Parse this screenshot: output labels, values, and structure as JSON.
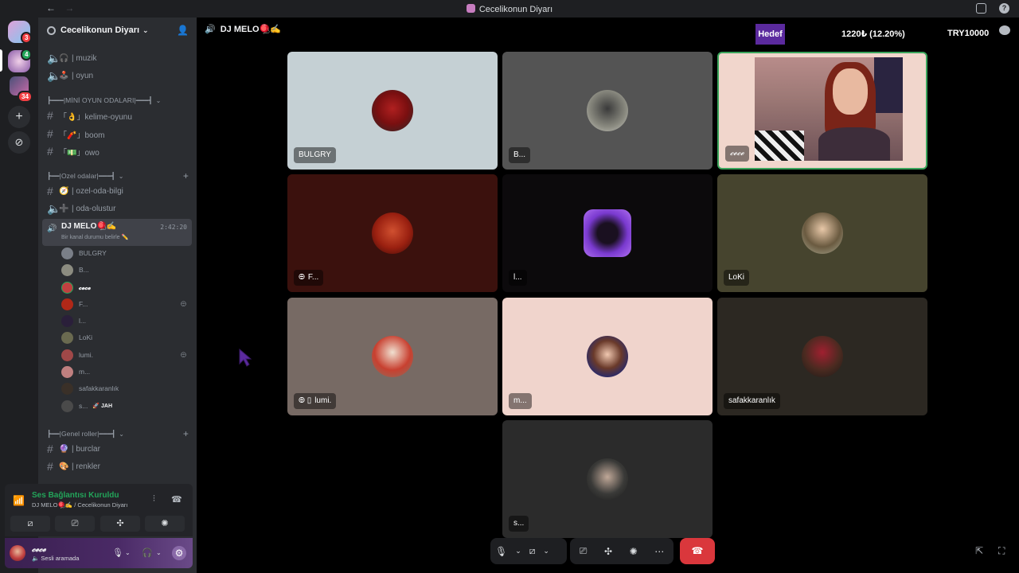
{
  "titlebar": {
    "title": "Cecelikonun Diyarı",
    "back": "←",
    "forward": "→"
  },
  "guilds": [
    {
      "badge": "3"
    },
    {
      "badge": "4"
    },
    {
      "badge": "34"
    }
  ],
  "server": {
    "name": "Cecelikonun Diyarı"
  },
  "channels_top": [
    {
      "emoji": "🎧",
      "label": "| muzik"
    },
    {
      "emoji": "🕹️",
      "label": "| oyun"
    }
  ],
  "categories": {
    "mini": "┣━━━|MİNİ OYUN ODALARI|━━━┫",
    "ozel": "┣━━|Ozel odalar|━━━┫",
    "genel": "┣━━|Genel roller|━━━┫"
  },
  "mini_channels": [
    {
      "emoji": "👌",
      "label": "「👌」kelime-oyunu"
    },
    {
      "emoji": "🧨",
      "label": "「🧨」boom"
    },
    {
      "emoji": "💵",
      "label": "「💵」owo"
    }
  ],
  "ozel_channels": [
    {
      "emoji": "🧭",
      "label": "| ozel-oda-bilgi"
    },
    {
      "emoji": "➕",
      "label": "| oda-olustur"
    }
  ],
  "active_channel": {
    "name": "DJ MELO🪀✍️",
    "status": "Bir kanal durumu belirle ✏️",
    "time": "2:42:20"
  },
  "voice_users": [
    {
      "name": "BULGRY",
      "color": "#7a7f88",
      "muted": ""
    },
    {
      "name": "B...",
      "color": "#8c8c80",
      "muted": ""
    },
    {
      "name": "𝓬𝓮𝓬𝓮",
      "color": "#c04040",
      "muted": ""
    },
    {
      "name": "F...",
      "color": "#b02818",
      "muted": "⨸"
    },
    {
      "name": "l...",
      "color": "#2a1f3a",
      "muted": ""
    },
    {
      "name": "LoKi",
      "color": "#6a6a50",
      "muted": ""
    },
    {
      "name": "lumi.",
      "color": "#a04848",
      "muted": "⨸"
    },
    {
      "name": "m...",
      "color": "#c08080",
      "muted": ""
    },
    {
      "name": "safakkaranlık",
      "color": "#3a3028",
      "muted": ""
    },
    {
      "name": "s...",
      "color": "#4a4a4a",
      "muted": "",
      "tag": "🚀 JAH"
    }
  ],
  "genel_channels": [
    {
      "emoji": "🔮",
      "label": "| burclar"
    },
    {
      "emoji": "🎨",
      "label": "| renkler"
    }
  ],
  "rtc": {
    "status": "Ses Bağlantısı Kuruldu",
    "location": "DJ MELO🪀✍️ / Cecelikonun Diyarı"
  },
  "user": {
    "name": "𝓬𝓮𝓬𝓮",
    "status": "🔈 Sesli aramada"
  },
  "header": {
    "channel": "DJ MELO🪀✍️"
  },
  "goal": {
    "label": "Hedef",
    "value": "1220₺ (12.20%)",
    "target": "TRY10000",
    "progress": 0.122
  },
  "tiles": [
    {
      "name": "BULGRY",
      "icons": ""
    },
    {
      "name": "B...",
      "icons": ""
    },
    {
      "name": "𝓬𝓮𝓬𝓮",
      "icons": ""
    },
    {
      "name": "F...",
      "icons": "⨸"
    },
    {
      "name": "l...",
      "icons": ""
    },
    {
      "name": "LoKi",
      "icons": ""
    },
    {
      "name": "lumi.",
      "icons": "⨸ ▯"
    },
    {
      "name": "m...",
      "icons": ""
    },
    {
      "name": "safakkaranlık",
      "icons": ""
    },
    {
      "name": "s...",
      "icons": ""
    }
  ]
}
